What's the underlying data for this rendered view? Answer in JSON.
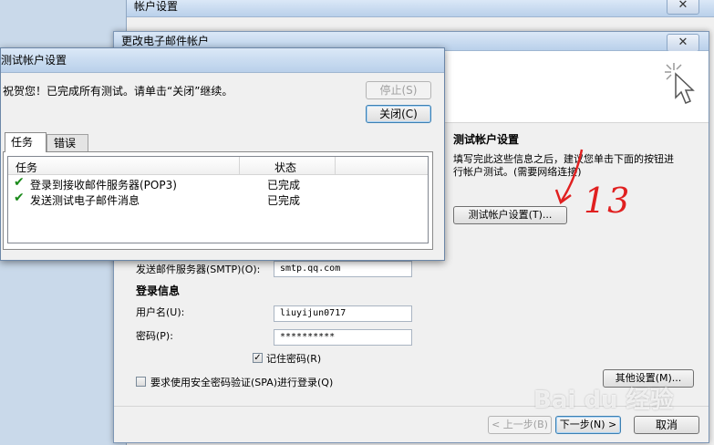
{
  "bg_window": {
    "title": "帐户设置"
  },
  "main_dialog": {
    "title": "更改电子邮件帐户",
    "close": "✕",
    "test_section": {
      "title": "测试帐户设置",
      "desc_line1": "填写完此这些信息之后，建议您单击下面的按钮进",
      "desc_line2": "行帐户测试。(需要网络连接)",
      "test_button": "测试帐户设置(T)..."
    },
    "smtp_label": "发送邮件服务器(SMTP)(O):",
    "smtp_value": "smtp.qq.com",
    "login_heading": "登录信息",
    "username_label": "用户名(U):",
    "username_value": "liuyijun0717",
    "password_label": "密码(P):",
    "password_value": "**********",
    "remember_label": "记住密码(R)",
    "spa_label": "要求使用安全密码验证(SPA)进行登录(Q)",
    "more_settings": "其他设置(M)...",
    "back_button": "< 上一步(B)",
    "next_button": "下一步(N) >",
    "cancel_button": "取消"
  },
  "test_dialog": {
    "title": "测试帐户设置",
    "message": "祝贺您！已完成所有测试。请单击“关闭”继续。",
    "stop_button": "停止(S)",
    "close_button": "关闭(C)",
    "tabs": [
      "任务",
      "错误"
    ],
    "columns": [
      "任务",
      "状态"
    ],
    "rows": [
      {
        "task": "登录到接收邮件服务器(POP3)",
        "status": "已完成"
      },
      {
        "task": "发送测试电子邮件消息",
        "status": "已完成"
      }
    ]
  },
  "annotation": {
    "text": "13"
  },
  "watermark": {
    "text": "Bai du 经验"
  }
}
